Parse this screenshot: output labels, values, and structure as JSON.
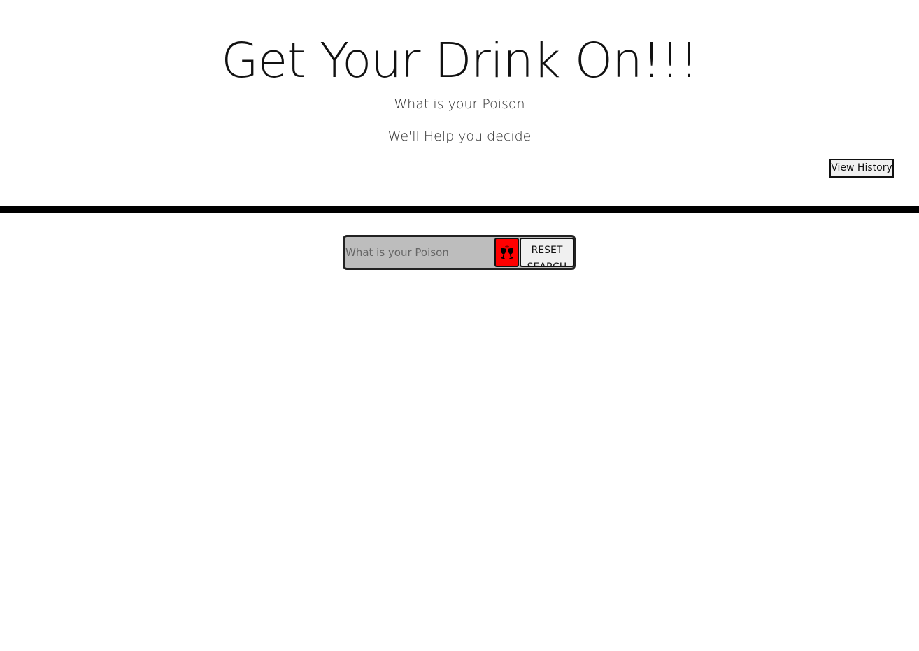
{
  "header": {
    "title": "Get Your Drink On!!!",
    "subtitle": "What is your Poison",
    "tagline": "We'll Help you decide",
    "history_button": "View History"
  },
  "search": {
    "placeholder": "What is your Poison",
    "value": "",
    "submit_icon": "cheers-glasses-icon",
    "reset_button": "RESET SEARCH"
  },
  "colors": {
    "divider": "#000000",
    "search_bg": "#bdbdbd",
    "submit_bg": "#ff0000"
  }
}
